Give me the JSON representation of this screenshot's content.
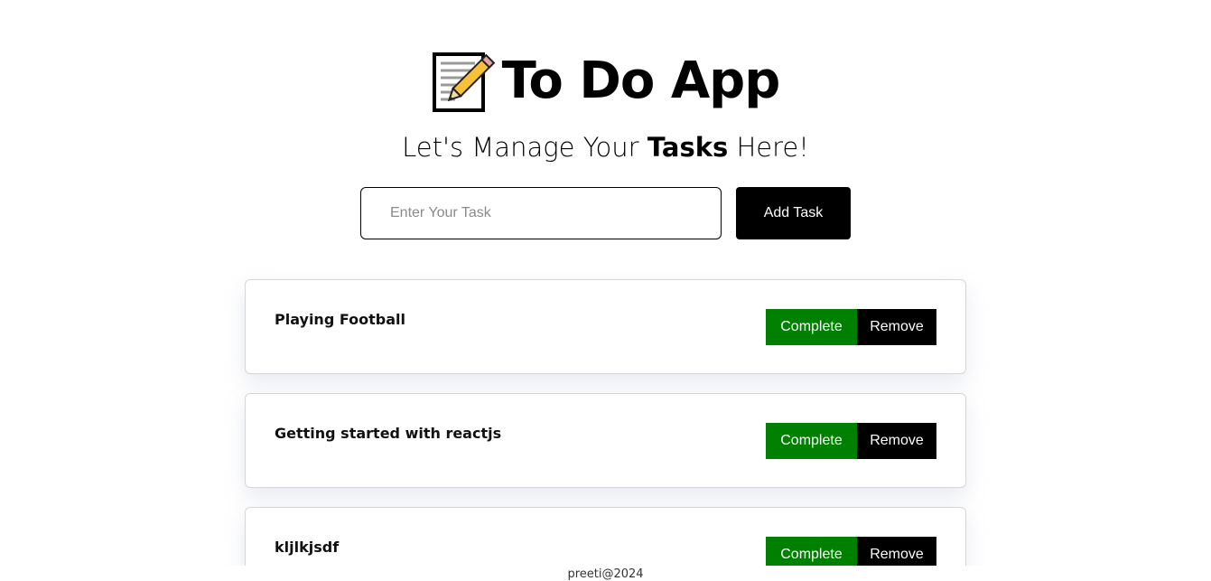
{
  "header": {
    "title": "To Do App",
    "title_icon": "memo-icon",
    "subtitle_prefix": "Let's Manage Your ",
    "subtitle_bold": "Tasks",
    "subtitle_suffix": " Here!"
  },
  "form": {
    "input_value": "",
    "input_placeholder": "Enter Your Task",
    "add_button_label": "Add Task"
  },
  "tasks": [
    {
      "text": "Playing Football",
      "complete_label": "Complete",
      "remove_label": "Remove"
    },
    {
      "text": "Getting started with reactjs",
      "complete_label": "Complete",
      "remove_label": "Remove"
    },
    {
      "text": "kljlkjsdf",
      "complete_label": "Complete",
      "remove_label": "Remove"
    }
  ],
  "footer": {
    "text": "preeti@2024"
  },
  "colors": {
    "complete": "#008000",
    "remove": "#000000",
    "add_button": "#000000"
  }
}
